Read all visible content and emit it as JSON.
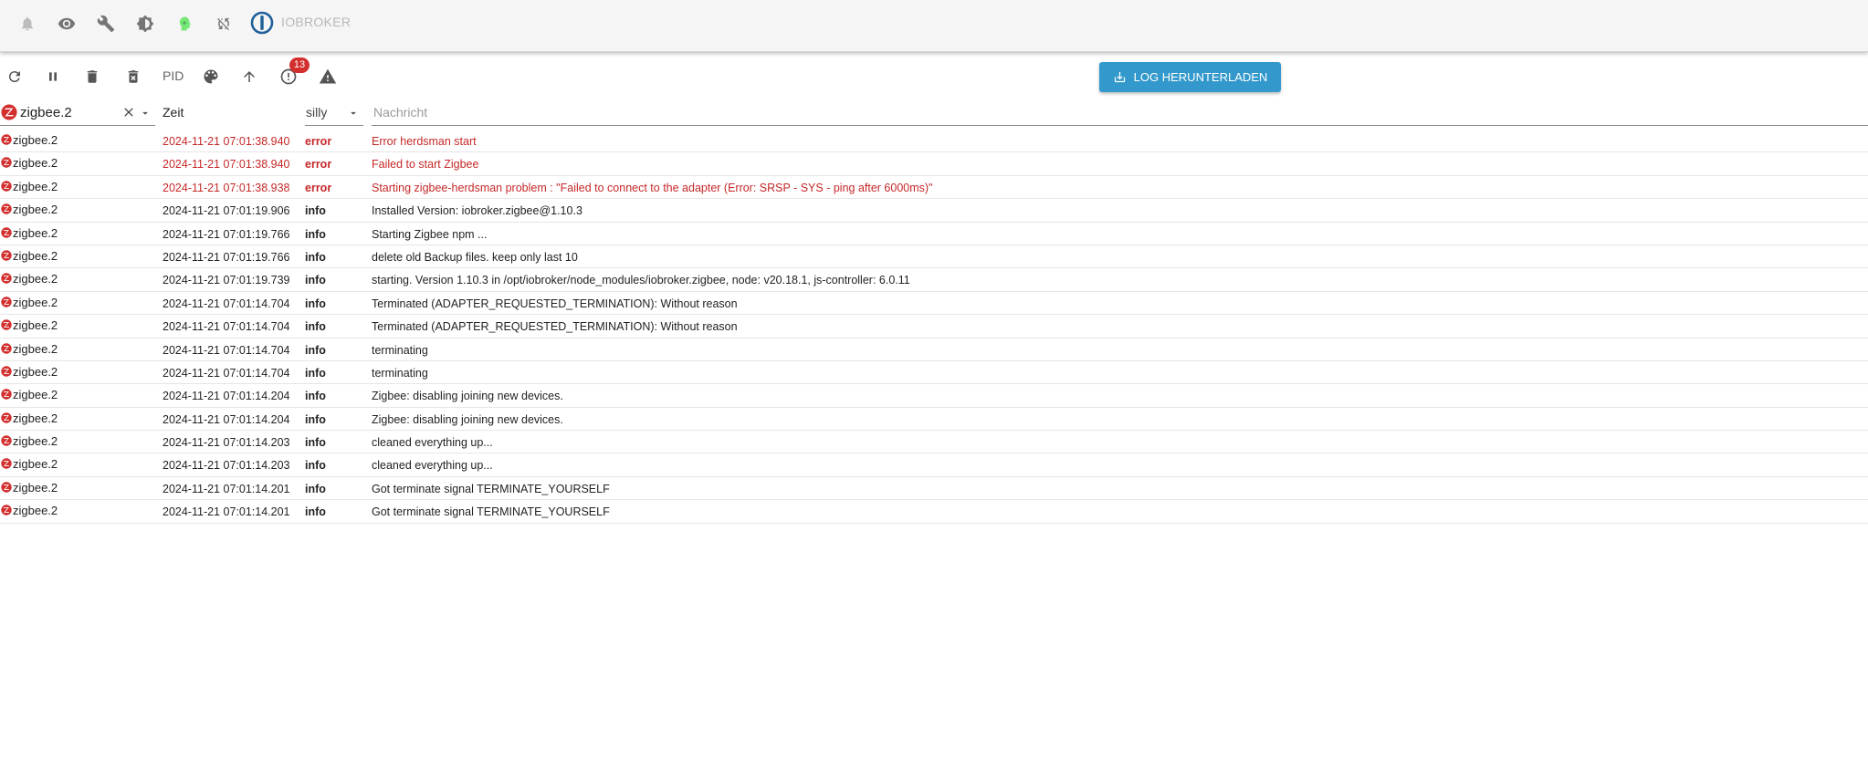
{
  "header": {
    "brand_text": "IOBROKER",
    "icons": [
      "bell-icon",
      "eye-icon",
      "wrench-icon",
      "brightness-icon",
      "user-head-icon",
      "sync-disabled-icon",
      "iobroker-logo"
    ]
  },
  "toolbar": {
    "pid_label": "PID",
    "badge_count": "13",
    "download_label": "LOG HERUNTERLADEN"
  },
  "filters": {
    "source_value": "zigbee.2",
    "time_label": "Zeit",
    "level_value": "silly",
    "message_placeholder": "Nachricht"
  },
  "colors": {
    "accent": "#3399cc",
    "error": "#c62828",
    "badge": "#d32f2f"
  },
  "log_rows": [
    {
      "source": "zigbee.2",
      "time": "2024-11-21 07:01:38.940",
      "level": "error",
      "message": "Error herdsman start"
    },
    {
      "source": "zigbee.2",
      "time": "2024-11-21 07:01:38.940",
      "level": "error",
      "message": "Failed to start Zigbee"
    },
    {
      "source": "zigbee.2",
      "time": "2024-11-21 07:01:38.938",
      "level": "error",
      "message": "Starting zigbee-herdsman problem : \"Failed to connect to the adapter (Error: SRSP - SYS - ping after 6000ms)\""
    },
    {
      "source": "zigbee.2",
      "time": "2024-11-21 07:01:19.906",
      "level": "info",
      "message": "Installed Version: iobroker.zigbee@1.10.3"
    },
    {
      "source": "zigbee.2",
      "time": "2024-11-21 07:01:19.766",
      "level": "info",
      "message": "Starting Zigbee npm ..."
    },
    {
      "source": "zigbee.2",
      "time": "2024-11-21 07:01:19.766",
      "level": "info",
      "message": "delete old Backup files. keep only last 10"
    },
    {
      "source": "zigbee.2",
      "time": "2024-11-21 07:01:19.739",
      "level": "info",
      "message": "starting. Version 1.10.3 in /opt/iobroker/node_modules/iobroker.zigbee, node: v20.18.1, js-controller: 6.0.11"
    },
    {
      "source": "zigbee.2",
      "time": "2024-11-21 07:01:14.704",
      "level": "info",
      "message": "Terminated (ADAPTER_REQUESTED_TERMINATION): Without reason"
    },
    {
      "source": "zigbee.2",
      "time": "2024-11-21 07:01:14.704",
      "level": "info",
      "message": "Terminated (ADAPTER_REQUESTED_TERMINATION): Without reason"
    },
    {
      "source": "zigbee.2",
      "time": "2024-11-21 07:01:14.704",
      "level": "info",
      "message": "terminating"
    },
    {
      "source": "zigbee.2",
      "time": "2024-11-21 07:01:14.704",
      "level": "info",
      "message": "terminating"
    },
    {
      "source": "zigbee.2",
      "time": "2024-11-21 07:01:14.204",
      "level": "info",
      "message": "Zigbee: disabling joining new devices."
    },
    {
      "source": "zigbee.2",
      "time": "2024-11-21 07:01:14.204",
      "level": "info",
      "message": "Zigbee: disabling joining new devices."
    },
    {
      "source": "zigbee.2",
      "time": "2024-11-21 07:01:14.203",
      "level": "info",
      "message": "cleaned everything up..."
    },
    {
      "source": "zigbee.2",
      "time": "2024-11-21 07:01:14.203",
      "level": "info",
      "message": "cleaned everything up..."
    },
    {
      "source": "zigbee.2",
      "time": "2024-11-21 07:01:14.201",
      "level": "info",
      "message": "Got terminate signal TERMINATE_YOURSELF"
    },
    {
      "source": "zigbee.2",
      "time": "2024-11-21 07:01:14.201",
      "level": "info",
      "message": "Got terminate signal TERMINATE_YOURSELF"
    }
  ]
}
